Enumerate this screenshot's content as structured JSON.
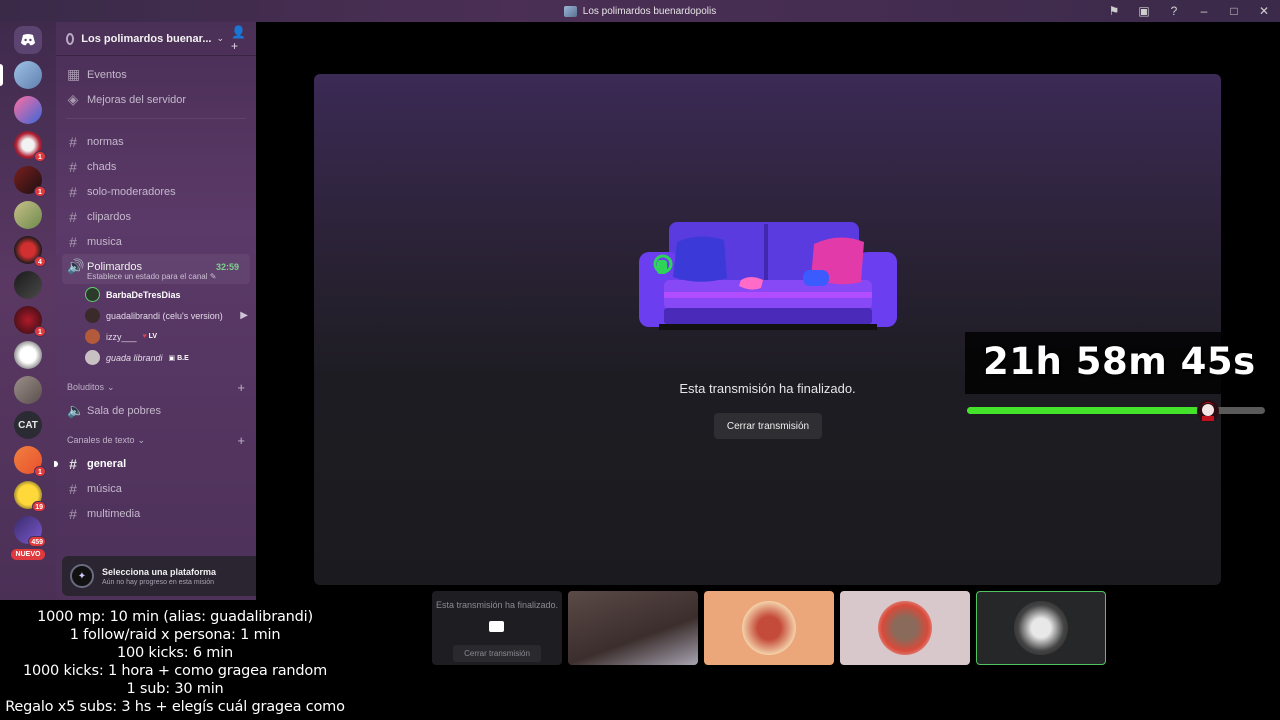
{
  "window": {
    "title": "Los polimardos buenardopolis"
  },
  "rail": {
    "badges": [
      "1",
      "1",
      "4",
      "1",
      "1",
      "19",
      "459"
    ],
    "cat_label": "CAT",
    "new_label": "NUEVO"
  },
  "sidebar": {
    "server_name": "Los polimardos buenar...",
    "top_items": [
      {
        "label": "Eventos",
        "icon": "calendar-icon"
      },
      {
        "label": "Mejoras del servidor",
        "icon": "boost-icon"
      }
    ],
    "channels": [
      "normas",
      "chads",
      "solo-moderadores",
      "clipardos",
      "musica"
    ],
    "voice_channel": {
      "name": "Polimardos",
      "timer": "32:59",
      "status": "Establece un estado para el canal",
      "users": [
        {
          "name": "BarbaDeTresDias",
          "tag": ""
        },
        {
          "name": "guadalibrandi (celu's version)",
          "tag": ""
        },
        {
          "name": "izzy___",
          "tag": "LV"
        },
        {
          "name": "guada librandi",
          "tag": "B.E"
        }
      ]
    },
    "category_boludito": {
      "title": "Boluditos",
      "channels": [
        "Sala de pobres"
      ]
    },
    "category_text": {
      "title": "Canales de texto",
      "channels": [
        "general",
        "música",
        "multimedia"
      ]
    },
    "quest": {
      "title": "Selecciona una plataforma",
      "subtitle": "Aún no hay progreso en esta misión"
    }
  },
  "stage": {
    "ended_text": "Esta transmisión ha finalizado.",
    "close_button": "Cerrar transmisión"
  },
  "tiles": {
    "ended_text": "Esta transmisión ha finalizado.",
    "close_button": "Cerrar transmisión"
  },
  "overlay": {
    "timer": "21h 58m 45s",
    "progress": 0.78,
    "rules": [
      "1000 mp: 10 min (alias: guadalibrandi)",
      "1 follow/raid x persona: 1 min",
      "100 kicks: 6 min",
      "1000 kicks: 1 hora + como gragea random",
      "1 sub: 30 min",
      "Regalo x5 subs: 3 hs + elegís cuál gragea como"
    ]
  }
}
